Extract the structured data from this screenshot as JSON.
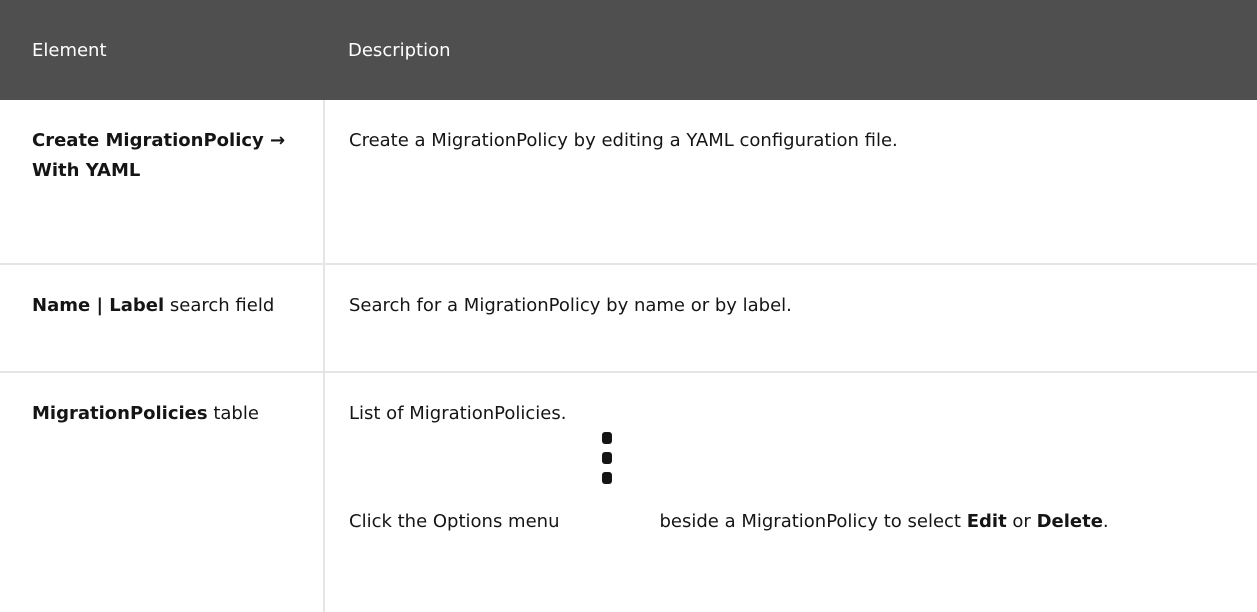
{
  "table": {
    "headers": [
      "Element",
      "Description"
    ],
    "rows": [
      {
        "element": "Create MigrationPolicy → With YAML",
        "description": "Create a MigrationPolicy by editing a YAML configuration file."
      },
      {
        "element_strong": "Name | Label",
        "element_rest": "search field",
        "description": "Search for a MigrationPolicy by name or by label."
      },
      {
        "element_strong": "MigrationPolicies",
        "element_rest": "table",
        "description": "List of MigrationPolicies.",
        "options": {
          "before": "Click the Options menu",
          "icon": "kebab-icon",
          "after": "beside a MigrationPolicy to select",
          "edit": "Edit",
          "or": "or",
          "delete": "Delete",
          "end": "."
        }
      }
    ]
  }
}
